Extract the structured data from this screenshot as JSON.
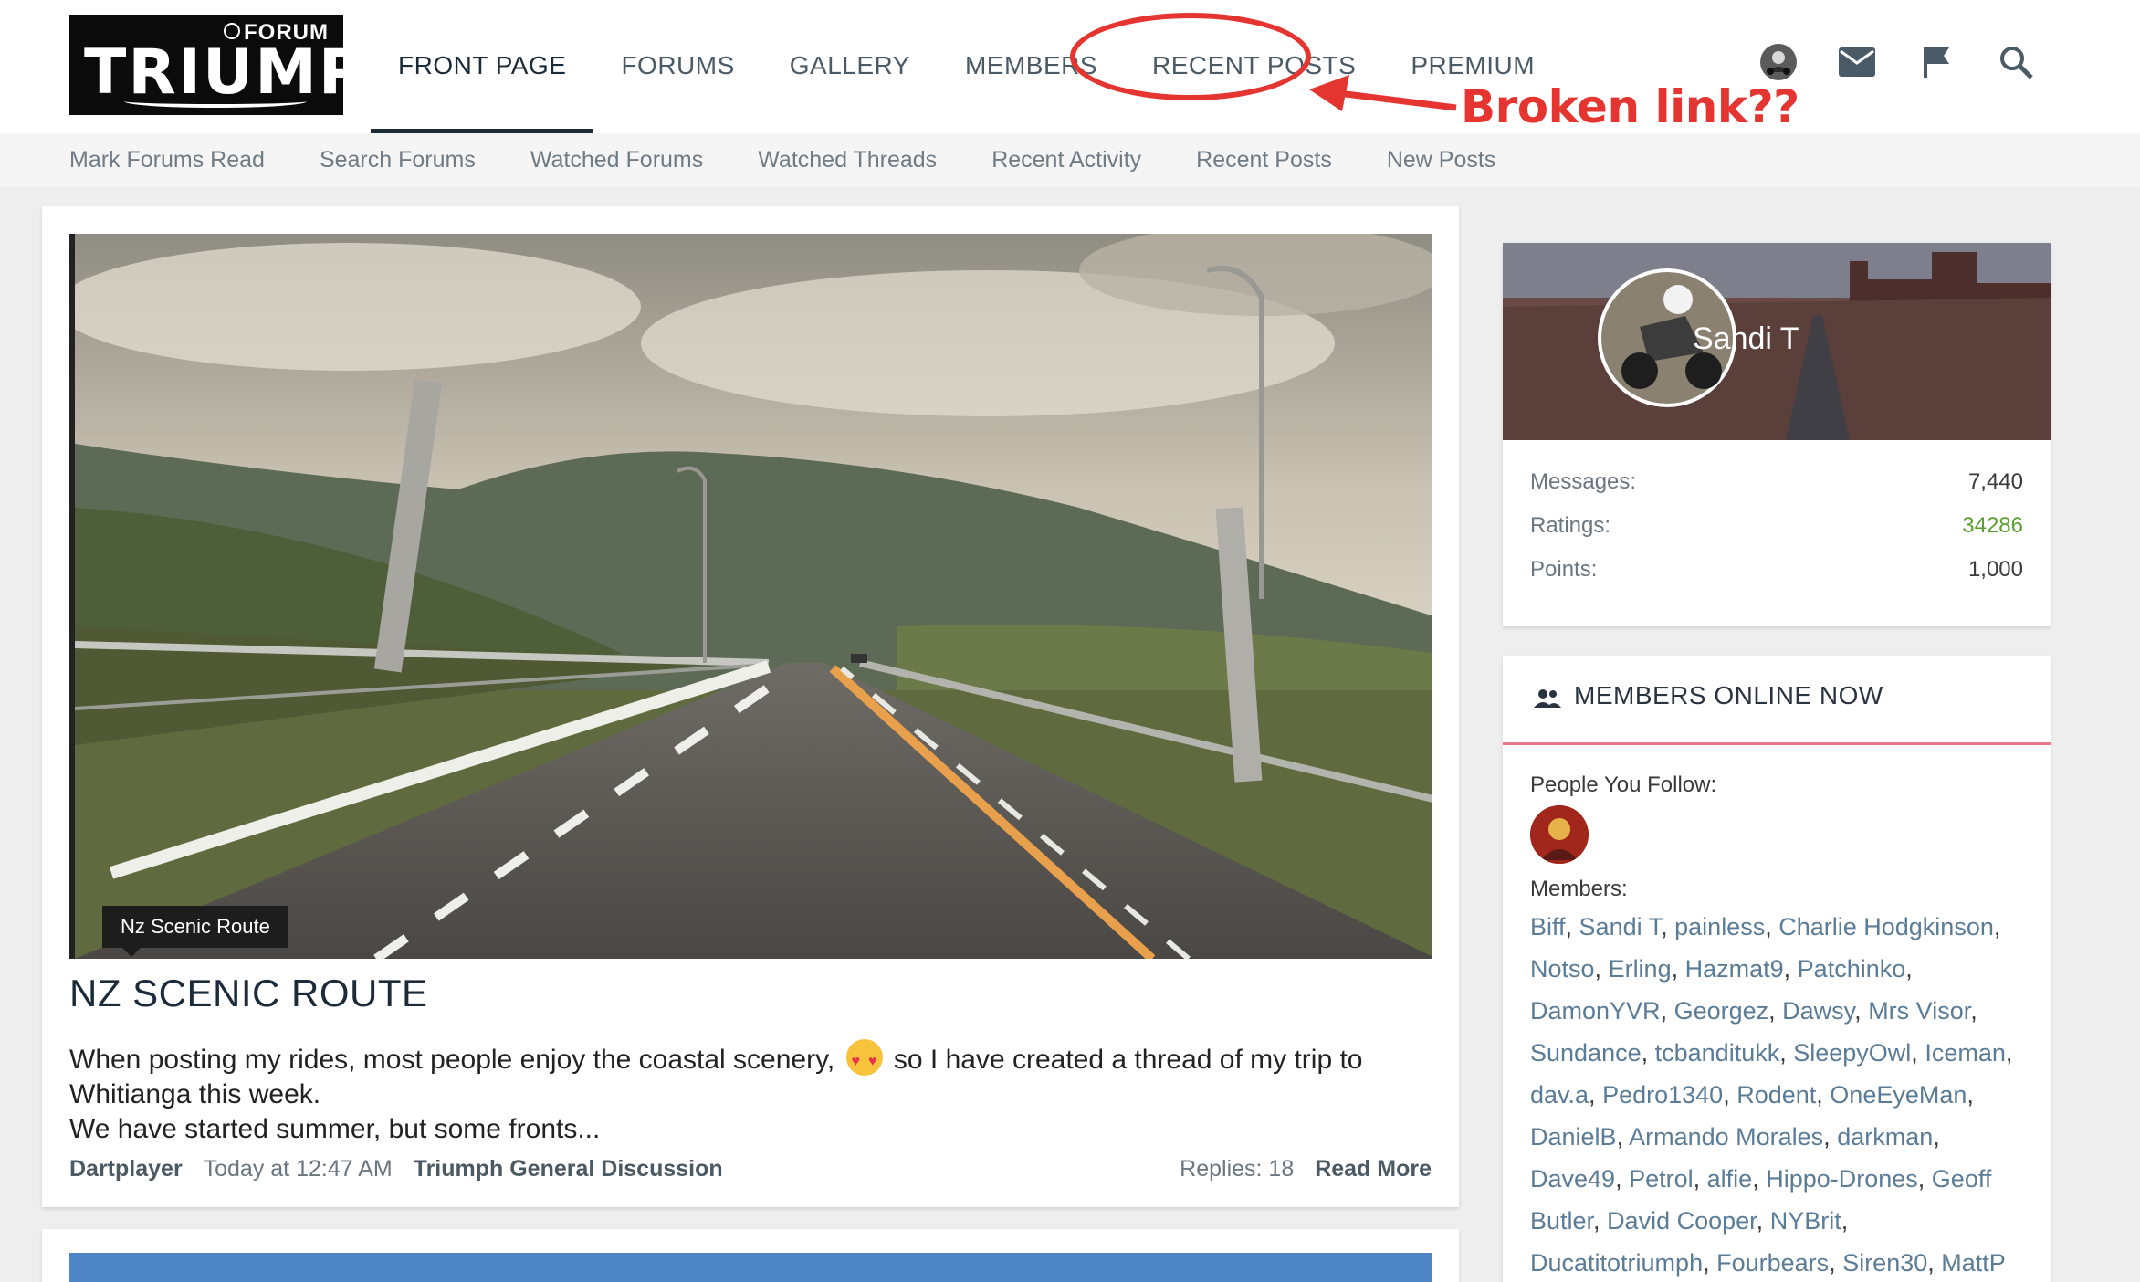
{
  "logo": {
    "top": "FORUM",
    "brand": "TRIUMPH"
  },
  "nav": [
    {
      "label": "FRONT PAGE",
      "active": true
    },
    {
      "label": "FORUMS"
    },
    {
      "label": "GALLERY"
    },
    {
      "label": "MEMBERS"
    },
    {
      "label": "RECENT POSTS"
    },
    {
      "label": "PREMIUM"
    }
  ],
  "header_icons": [
    "avatar",
    "mail-icon",
    "flag-icon",
    "search-icon"
  ],
  "subnav": [
    "Mark Forums Read",
    "Search Forums",
    "Watched Forums",
    "Watched Threads",
    "Recent Activity",
    "Recent Posts",
    "New Posts"
  ],
  "annotation": {
    "text": "Broken link??",
    "color": "#e53530"
  },
  "post": {
    "tag": "Nz Scenic Route",
    "title": "NZ SCENIC ROUTE",
    "body_1": "When posting my rides, most people enjoy the coastal scenery,",
    "body_2": "so I have created a thread of my trip to Whitianga this week.",
    "body_3": "We have started summer, but some fronts...",
    "author": "Dartplayer",
    "time": "Today at 12:47 AM",
    "forum": "Triumph General Discussion",
    "replies": "Replies: 18",
    "read_more": "Read More"
  },
  "profile": {
    "name": "Sandi T",
    "stats": [
      {
        "label": "Messages:",
        "value": "7,440"
      },
      {
        "label": "Ratings:",
        "value": "34286"
      },
      {
        "label": "Points:",
        "value": "1,000"
      }
    ]
  },
  "online": {
    "title": "MEMBERS ONLINE NOW",
    "follow_label": "People You Follow:",
    "members_label": "Members:",
    "members": [
      "Biff",
      "Sandi T",
      "painless",
      "Charlie Hodgkinson",
      "Notso",
      "Erling",
      "Hazmat9",
      "Patchinko",
      "DamonYVR",
      "Georgez",
      "Dawsy",
      "Mrs Visor",
      "Sundance",
      "tcbanditukk",
      "SleepyOwl",
      "Iceman",
      "dav.a",
      "Pedro1340",
      "Rodent",
      "OneEyeMan",
      "DanielB",
      "Armando Morales",
      "darkman",
      "Dave49",
      "Petrol",
      "alfie",
      "Hippo-Drones",
      "Geoff Butler",
      "David Cooper",
      "NYBrit",
      "Ducatitotriumph",
      "Fourbears",
      "Siren30",
      "MattP"
    ]
  },
  "colors": {
    "accent": "#1c2b3a",
    "annotation": "#e53530",
    "link": "#5b7c97",
    "rating": "#5a9e2f"
  }
}
